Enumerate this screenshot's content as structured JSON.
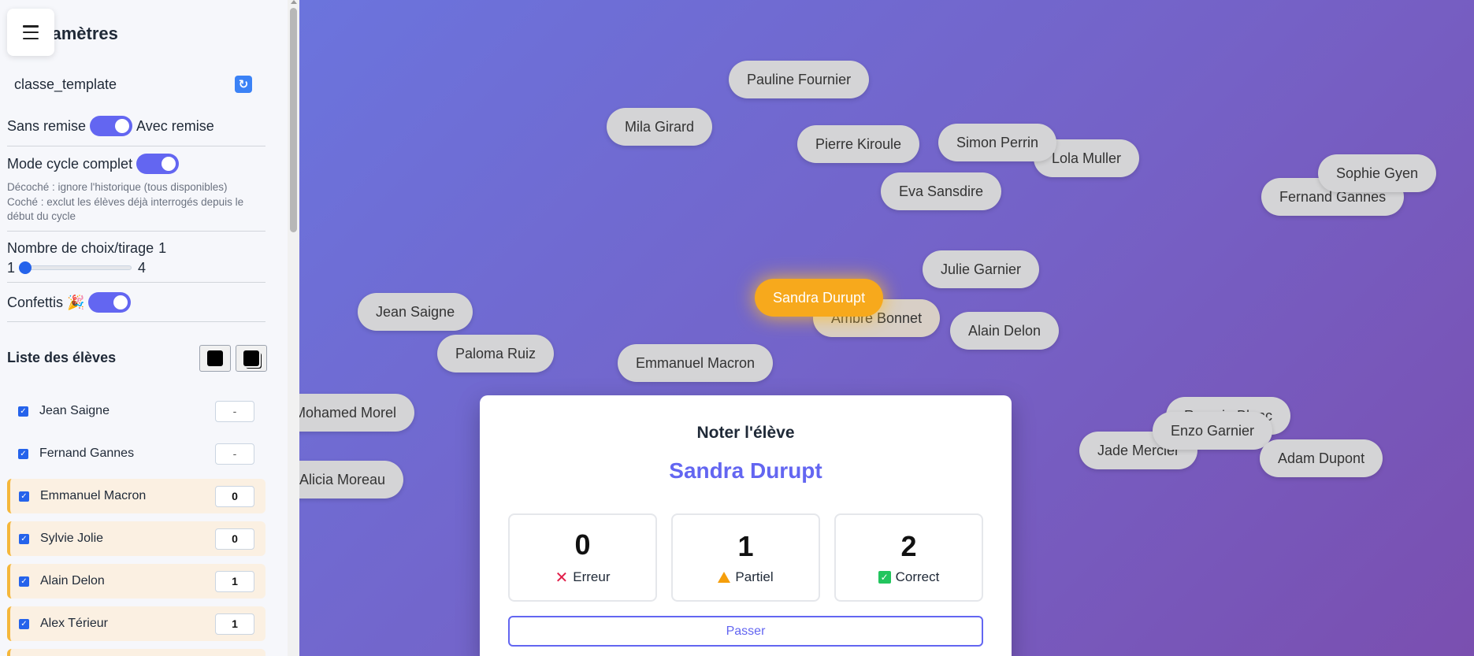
{
  "sidebar": {
    "title": "Paramètres",
    "template_name": "classe_template",
    "refresh_icon": "refresh-icon",
    "draw_mode": {
      "left_label": "Sans remise",
      "right_label": "Avec remise",
      "enabled": true
    },
    "cycle_mode": {
      "label": "Mode cycle complet",
      "enabled": true,
      "hint_unchecked": "Décoché : ignore l'historique (tous disponibles)",
      "hint_checked": "Coché : exclut les élèves déjà interrogés depuis le début du cycle"
    },
    "choices_per_draw": {
      "label": "Nombre de choix/tirage",
      "value": "1",
      "min": "1",
      "max": "4"
    },
    "confetti": {
      "label": "Confettis 🎉",
      "enabled": true
    },
    "students_header": "Liste des élèves",
    "students": [
      {
        "name": "Jean Saigne",
        "score": "-",
        "highlighted": false
      },
      {
        "name": "Fernand Gannes",
        "score": "-",
        "highlighted": false
      },
      {
        "name": "Emmanuel Macron",
        "score": "0",
        "highlighted": true
      },
      {
        "name": "Sylvie Jolie",
        "score": "0",
        "highlighted": true
      },
      {
        "name": "Alain Delon",
        "score": "1",
        "highlighted": true
      },
      {
        "name": "Alex Térieur",
        "score": "1",
        "highlighted": true
      }
    ]
  },
  "stage": {
    "chips": [
      "Pauline Fournier",
      "Mila Girard",
      "Pierre Kiroule",
      "Simon Perrin",
      "Lola Muller",
      "Eva Sansdire",
      "Sophie Gyen",
      "Fernand Gannes",
      "Julie Garnier",
      "Sandra Durupt",
      "Ambre Bonnet",
      "Alain Delon",
      "Jean Saigne",
      "Paloma Ruiz",
      "Emmanuel Macron",
      "Mohamed Morel",
      "Alicia Moreau",
      "Romain Blanc",
      "Enzo Garnier",
      "Jade Mercier",
      "Adam Dupont"
    ],
    "selected": "Sandra Durupt"
  },
  "modal": {
    "title": "Noter l'élève",
    "student": "Sandra Durupt",
    "grades": [
      {
        "value": "0",
        "label": "Erreur",
        "icon": "cross-icon"
      },
      {
        "value": "1",
        "label": "Partiel",
        "icon": "warning-icon"
      },
      {
        "value": "2",
        "label": "Correct",
        "icon": "check-icon"
      }
    ],
    "pass_label": "Passer"
  },
  "colors": {
    "accent": "#6366f1",
    "selected_chip": "#f7a91c",
    "highlight_row": "#fbf0e2",
    "highlight_border": "#f5b73b"
  }
}
